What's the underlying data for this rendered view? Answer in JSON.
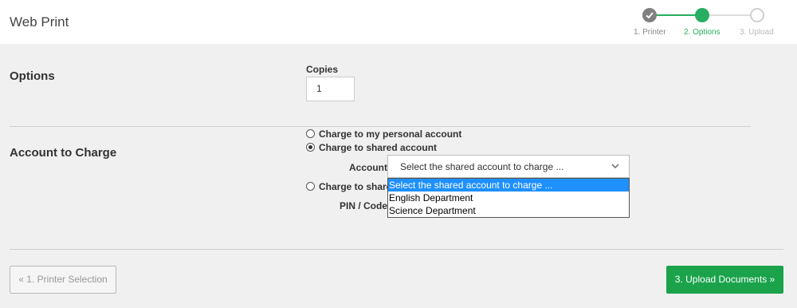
{
  "app": {
    "title": "Web Print"
  },
  "stepper": {
    "steps": [
      {
        "label": "1. Printer",
        "state": "completed"
      },
      {
        "label": "2. Options",
        "state": "active"
      },
      {
        "label": "3. Upload",
        "state": "pending"
      }
    ]
  },
  "options": {
    "heading": "Options",
    "copies_label": "Copies",
    "copies_value": "1"
  },
  "account": {
    "heading": "Account to Charge",
    "radios": [
      {
        "label": "Charge to my personal account",
        "checked": false
      },
      {
        "label": "Charge to shared account",
        "checked": true
      },
      {
        "label": "Charge to shared",
        "checked": false
      }
    ],
    "account_label": "Account",
    "pin_label": "PIN / Code",
    "select_value": "Select the shared account to charge ...",
    "dropdown_options": [
      "Select the shared account to charge ...",
      "English Department",
      "Science Department"
    ]
  },
  "buttons": {
    "prev": "« 1. Printer Selection",
    "next": "3. Upload Documents »"
  },
  "colors": {
    "accent": "#1aa34a",
    "step_active": "#27ae60",
    "highlight": "#1e90ff",
    "background": "#f0f0f0"
  },
  "icons": {
    "step_done": "check-icon",
    "select": "chevron-down-icon"
  }
}
